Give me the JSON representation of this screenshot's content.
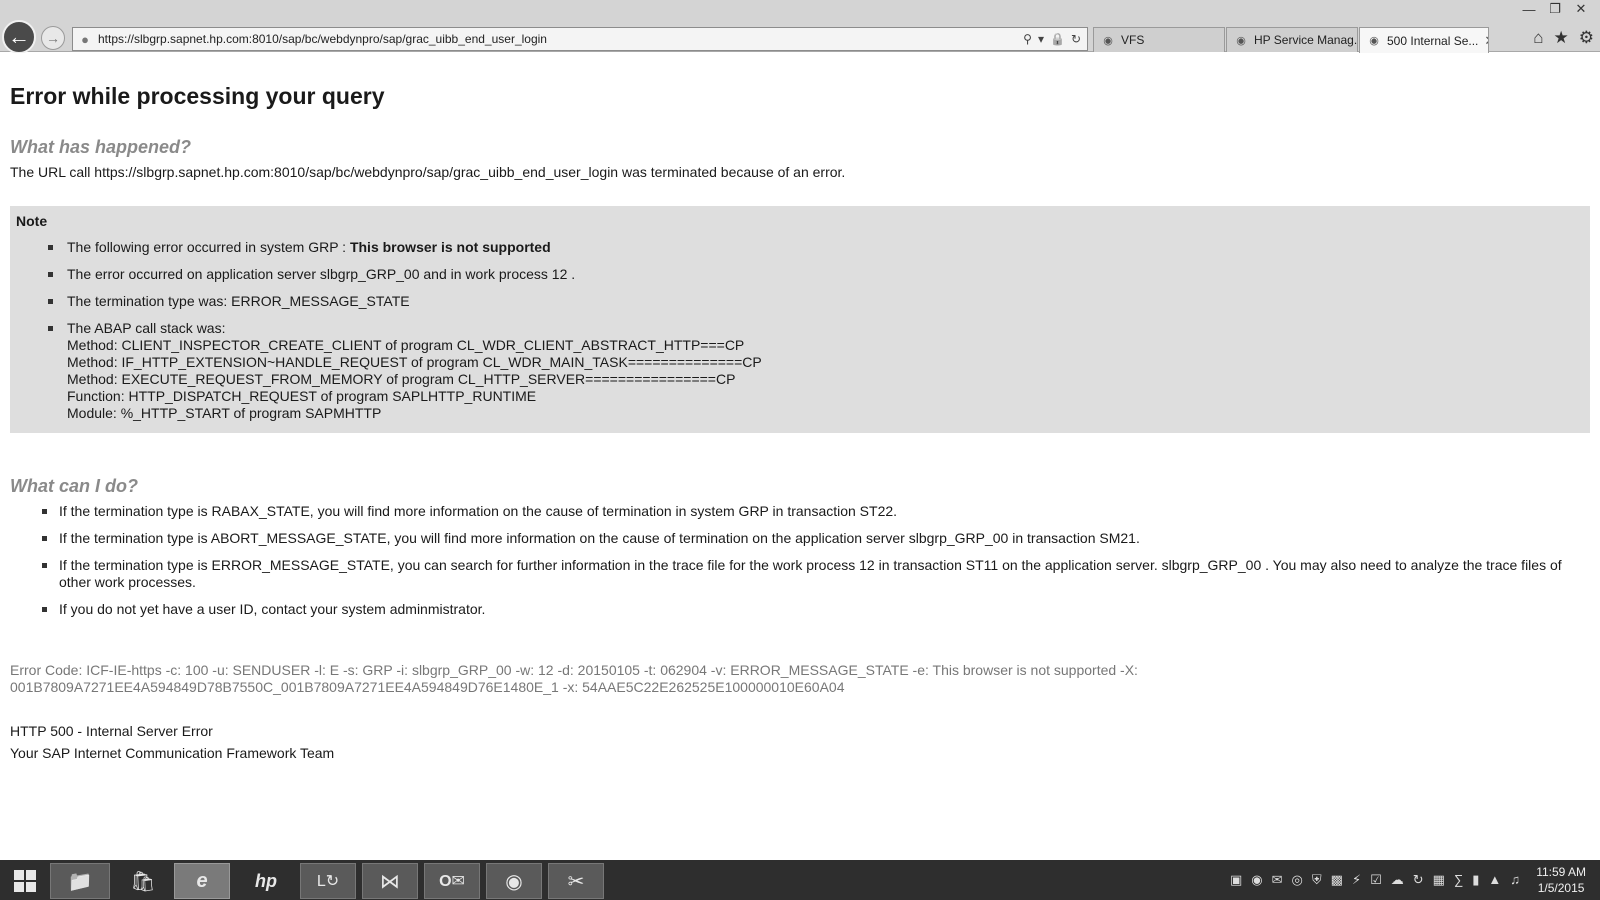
{
  "browser": {
    "address_url": "https://slbgrp.sapnet.hp.com:8010/sap/bc/webdynpro/sap/grac_uibb_end_user_login",
    "tabs": [
      {
        "label": "VFS",
        "icon": "ie-page-icon",
        "active": false
      },
      {
        "label": "HP Service Manag...",
        "icon": "hp-logo-icon",
        "active": false
      },
      {
        "label": "500 Internal Se...",
        "icon": "ie-page-icon",
        "active": true
      }
    ]
  },
  "page": {
    "title": "Error while processing your query",
    "what_happened_heading": "What has happened?",
    "url_call_text": "The URL call https://slbgrp.sapnet.hp.com:8010/sap/bc/webdynpro/sap/grac_uibb_end_user_login was terminated because of an error.",
    "note": {
      "title": "Note",
      "item1_prefix": "The following error occurred in system GRP : ",
      "item1_bold": "This browser is not supported",
      "item2": "The error occurred on application server slbgrp_GRP_00 and in work process 12 .",
      "item3": "The termination type was: ERROR_MESSAGE_STATE",
      "call_stack_intro": "The ABAP call stack was:",
      "call_stack": [
        "Method: CLIENT_INSPECTOR_CREATE_CLIENT of program CL_WDR_CLIENT_ABSTRACT_HTTP===CP",
        "Method: IF_HTTP_EXTENSION~HANDLE_REQUEST of program CL_WDR_MAIN_TASK==============CP",
        "Method: EXECUTE_REQUEST_FROM_MEMORY of program CL_HTTP_SERVER================CP",
        "Function: HTTP_DISPATCH_REQUEST of program SAPLHTTP_RUNTIME",
        "Module: %_HTTP_START of program SAPMHTTP"
      ]
    },
    "what_can_i_do_heading": "What can I do?",
    "cando_items": [
      "If the termination type is RABAX_STATE, you will find more information on the cause of termination in system GRP in transaction ST22.",
      "If the termination type is ABORT_MESSAGE_STATE, you will find more information on the cause of termination on the application server slbgrp_GRP_00 in transaction SM21.",
      "If the termination type is ERROR_MESSAGE_STATE, you can search for further information in the trace file for the work process 12 in transaction ST11 on the application server. slbgrp_GRP_00 . You may also need to analyze the trace files of other work processes.",
      "If you do not yet have a user ID, contact your system adminmistrator."
    ],
    "error_code": "Error Code: ICF-IE-https -c: 100 -u: SENDUSER -l: E -s: GRP -i: slbgrp_GRP_00 -w: 12 -d: 20150105 -t: 062904 -v: ERROR_MESSAGE_STATE -e: This browser is not supported -X: 001B7809A7271EE4A594849D78B7550C_001B7809A7271EE4A594849D76E1480E_1 -x: 54AAE5C22E262525E100000010E60A04",
    "http_status": "HTTP 500 - Internal Server Error",
    "team": "Your SAP Internet Communication Framework Team"
  },
  "taskbar": {
    "time": "11:59 AM",
    "date": "1/5/2015"
  }
}
